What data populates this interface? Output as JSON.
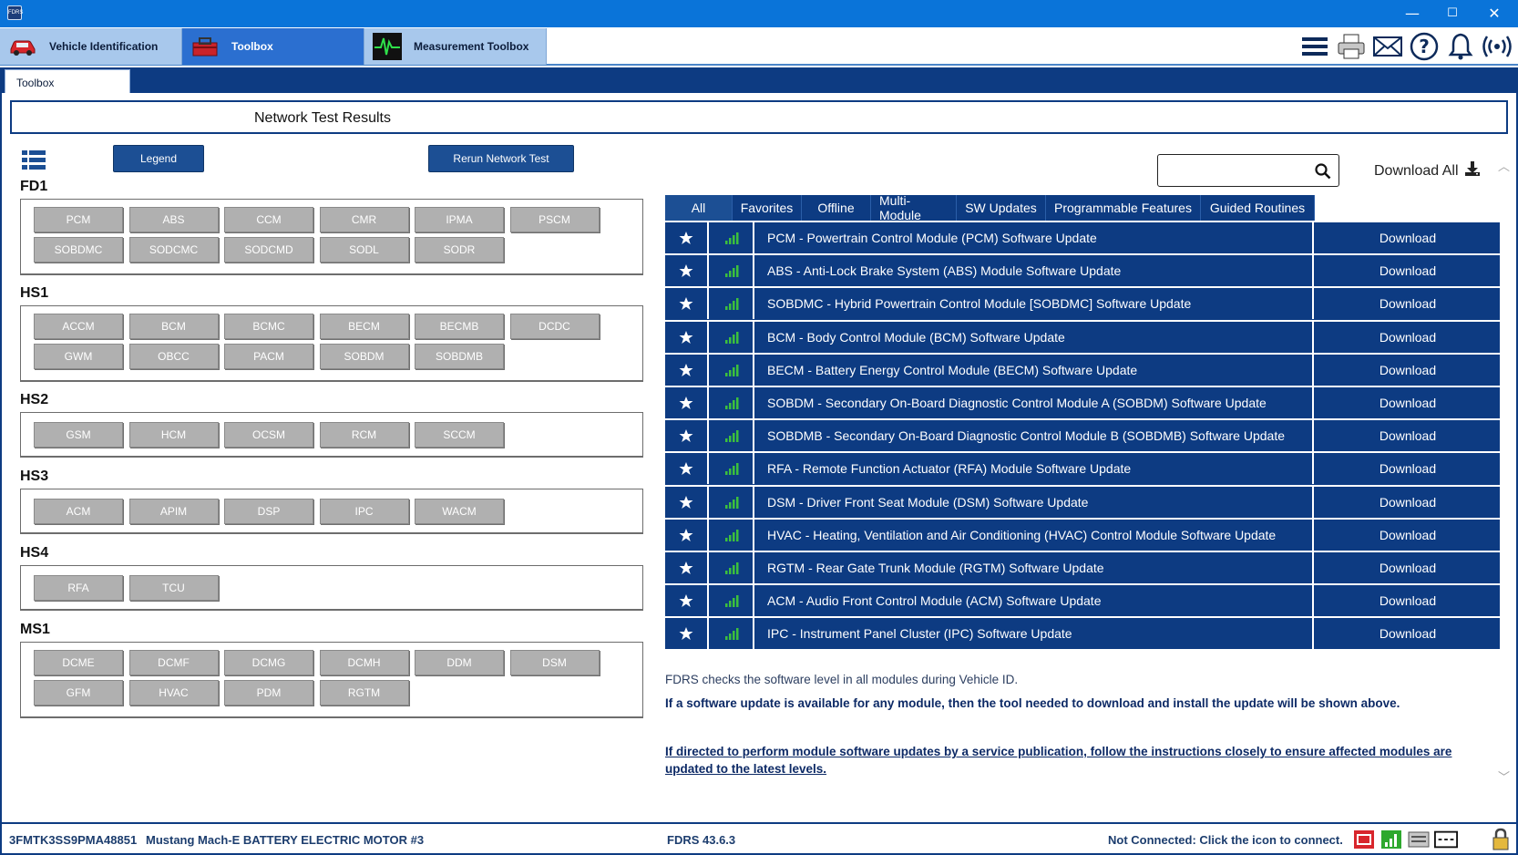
{
  "window": {
    "icon_label": "FDRS",
    "minimize": "—",
    "maximize": "☐",
    "close": "✕"
  },
  "module_tabs": [
    {
      "label": "Vehicle Identification",
      "icon": "car-icon"
    },
    {
      "label": "Toolbox",
      "icon": "toolbox-icon"
    },
    {
      "label": "Measurement Toolbox",
      "icon": "oscilloscope-icon"
    }
  ],
  "toolbar_icons": [
    "menu-icon",
    "printer-icon",
    "mail-icon",
    "help-icon",
    "bell-icon",
    "wireless-icon"
  ],
  "subtab": {
    "label": "Toolbox"
  },
  "page_title": "Network Test Results",
  "buttons": {
    "legend": "Legend",
    "rerun": "Rerun Network Test"
  },
  "groups": [
    {
      "name": "FD1",
      "modules": [
        "PCM",
        "ABS",
        "CCM",
        "CMR",
        "IPMA",
        "PSCM",
        "SOBDMC",
        "SODCMC",
        "SODCMD",
        "SODL",
        "SODR"
      ]
    },
    {
      "name": "HS1",
      "modules": [
        "ACCM",
        "BCM",
        "BCMC",
        "BECM",
        "BECMB",
        "DCDC",
        "GWM",
        "OBCC",
        "PACM",
        "SOBDM",
        "SOBDMB"
      ]
    },
    {
      "name": "HS2",
      "modules": [
        "GSM",
        "HCM",
        "OCSM",
        "RCM",
        "SCCM"
      ]
    },
    {
      "name": "HS3",
      "modules": [
        "ACM",
        "APIM",
        "DSP",
        "IPC",
        "WACM"
      ]
    },
    {
      "name": "HS4",
      "modules": [
        "RFA",
        "TCU"
      ]
    },
    {
      "name": "MS1",
      "modules": [
        "DCME",
        "DCMF",
        "DCMG",
        "DCMH",
        "DDM",
        "DSM",
        "GFM",
        "HVAC",
        "PDM",
        "RGTM"
      ]
    }
  ],
  "search": {
    "placeholder": ""
  },
  "download_all": "Download All",
  "filter_tabs": [
    "All",
    "Favorites",
    "Offline",
    "Multi-Module",
    "SW Updates",
    "Programmable Features",
    "Guided Routines"
  ],
  "updates": [
    {
      "name": "PCM - Powertrain Control Module (PCM) Software Update",
      "action": "Download"
    },
    {
      "name": "ABS - Anti-Lock Brake System (ABS) Module Software Update",
      "action": "Download"
    },
    {
      "name": "SOBDMC - Hybrid Powertrain Control Module [SOBDMC] Software Update",
      "action": "Download"
    },
    {
      "name": "BCM - Body Control Module (BCM) Software Update",
      "action": "Download"
    },
    {
      "name": "BECM - Battery Energy Control Module (BECM) Software Update",
      "action": "Download"
    },
    {
      "name": "SOBDM - Secondary On-Board Diagnostic Control Module A (SOBDM) Software Update",
      "action": "Download"
    },
    {
      "name": "SOBDMB - Secondary On-Board Diagnostic Control Module B (SOBDMB) Software Update",
      "action": "Download"
    },
    {
      "name": "RFA - Remote Function Actuator (RFA) Module Software Update",
      "action": "Download"
    },
    {
      "name": "DSM - Driver Front Seat Module (DSM) Software Update",
      "action": "Download"
    },
    {
      "name": "HVAC - Heating, Ventilation and Air Conditioning (HVAC) Control Module Software Update",
      "action": "Download"
    },
    {
      "name": "RGTM - Rear Gate Trunk Module (RGTM) Software Update",
      "action": "Download"
    },
    {
      "name": "ACM - Audio Front Control Module (ACM) Software Update",
      "action": "Download"
    },
    {
      "name": "IPC - Instrument Panel Cluster (IPC) Software Update",
      "action": "Download"
    }
  ],
  "notes": {
    "line1": "FDRS checks the software level in all modules during Vehicle ID.",
    "line2": "If a software update is available for any module, then the tool needed to download and install the update will be shown above.",
    "line3": "If directed to perform module software updates by a service publication, follow the instructions closely to ensure affected modules are updated to the latest levels."
  },
  "status": {
    "vin": "3FMTK3SS9PMA48851",
    "vehicle": "Mustang Mach-E BATTERY ELECTRIC MOTOR #3",
    "version": "FDRS 43.6.3",
    "connection": "Not Connected: Click the icon to connect."
  },
  "colors": {
    "titlebar": "#0a74d9",
    "navy": "#0d3b82",
    "module_gray": "#b0b0b0",
    "signal_green": "#3cc13c"
  }
}
